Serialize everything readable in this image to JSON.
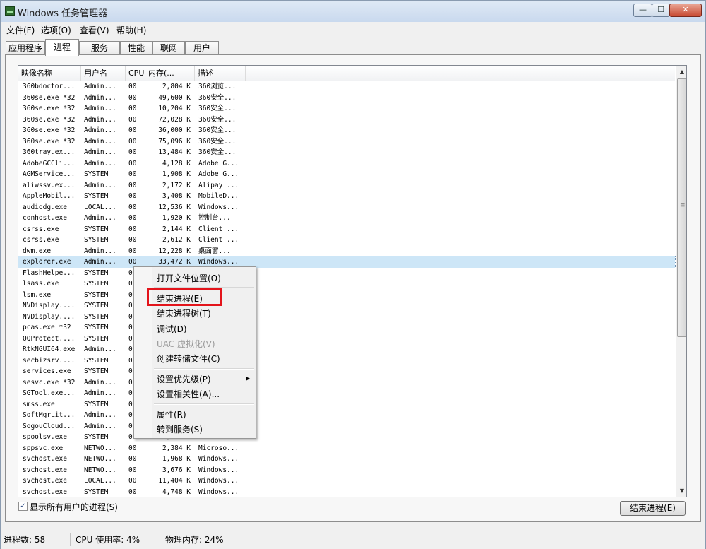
{
  "window": {
    "title": "Windows 任务管理器",
    "minimize_glyph": "—",
    "maximize_glyph": "☐",
    "close_glyph": "✕"
  },
  "menubar": {
    "items": [
      "文件(F)",
      "选项(O)",
      "查看(V)",
      "帮助(H)"
    ]
  },
  "tabs": {
    "items": [
      "应用程序",
      "进程",
      "服务",
      "性能",
      "联网",
      "用户"
    ],
    "active": "进程"
  },
  "process_table": {
    "columns": [
      "映像名称",
      "用户名",
      "CPU",
      "内存(...",
      "描述"
    ],
    "rows": [
      [
        "360bdoctor...",
        "Admin...",
        "00",
        "2,804 K",
        "360浏览..."
      ],
      [
        "360se.exe *32",
        "Admin...",
        "00",
        "49,600 K",
        "360安全..."
      ],
      [
        "360se.exe *32",
        "Admin...",
        "00",
        "10,204 K",
        "360安全..."
      ],
      [
        "360se.exe *32",
        "Admin...",
        "00",
        "72,028 K",
        "360安全..."
      ],
      [
        "360se.exe *32",
        "Admin...",
        "00",
        "36,000 K",
        "360安全..."
      ],
      [
        "360se.exe *32",
        "Admin...",
        "00",
        "75,096 K",
        "360安全..."
      ],
      [
        "360tray.ex...",
        "Admin...",
        "00",
        "13,484 K",
        "360安全..."
      ],
      [
        "AdobeGCCli...",
        "Admin...",
        "00",
        "4,128 K",
        "Adobe G..."
      ],
      [
        "AGMService...",
        "SYSTEM",
        "00",
        "1,908 K",
        "Adobe G..."
      ],
      [
        "aliwssv.ex...",
        "Admin...",
        "00",
        "2,172 K",
        "Alipay ..."
      ],
      [
        "AppleMobil...",
        "SYSTEM",
        "00",
        "3,408 K",
        "MobileD..."
      ],
      [
        "audiodg.exe",
        "LOCAL...",
        "00",
        "12,536 K",
        "Windows..."
      ],
      [
        "conhost.exe",
        "Admin...",
        "00",
        "1,920 K",
        "控制台..."
      ],
      [
        "csrss.exe",
        "SYSTEM",
        "00",
        "2,144 K",
        "Client ..."
      ],
      [
        "csrss.exe",
        "SYSTEM",
        "00",
        "2,612 K",
        "Client ..."
      ],
      [
        "dwm.exe",
        "Admin...",
        "00",
        "12,228 K",
        "桌面窗..."
      ],
      [
        "explorer.exe",
        "Admin...",
        "00",
        "33,472 K",
        "Windows..."
      ],
      [
        "FlashHelpe...",
        "SYSTEM",
        "0",
        "",
        ""
      ],
      [
        "lsass.exe",
        "SYSTEM",
        "0",
        "",
        ""
      ],
      [
        "lsm.exe",
        "SYSTEM",
        "0",
        "",
        ""
      ],
      [
        "NVDisplay....",
        "SYSTEM",
        "0",
        "",
        ""
      ],
      [
        "NVDisplay....",
        "SYSTEM",
        "0",
        "",
        ""
      ],
      [
        "pcas.exe *32",
        "SYSTEM",
        "0",
        "",
        ""
      ],
      [
        "QQProtect....",
        "SYSTEM",
        "0",
        "",
        ""
      ],
      [
        "RtkNGUI64.exe",
        "Admin...",
        "0",
        "",
        ""
      ],
      [
        "secbizsrv....",
        "SYSTEM",
        "0",
        "",
        ""
      ],
      [
        "services.exe",
        "SYSTEM",
        "0",
        "",
        ""
      ],
      [
        "sesvc.exe *32",
        "Admin...",
        "0",
        "",
        ""
      ],
      [
        "SGTool.exe...",
        "Admin...",
        "0",
        "",
        ""
      ],
      [
        "smss.exe",
        "SYSTEM",
        "0",
        "",
        ""
      ],
      [
        "SoftMgrLit...",
        "Admin...",
        "0",
        "",
        ""
      ],
      [
        "SogouCloud...",
        "Admin...",
        "0",
        "",
        ""
      ],
      [
        "spoolsv.exe",
        "SYSTEM",
        "00",
        "5,292 K",
        "后台处..."
      ],
      [
        "sppsvc.exe",
        "NETWO...",
        "00",
        "2,384 K",
        "Microso..."
      ],
      [
        "svchost.exe",
        "NETWO...",
        "00",
        "1,968 K",
        "Windows..."
      ],
      [
        "svchost.exe",
        "NETWO...",
        "00",
        "3,676 K",
        "Windows..."
      ],
      [
        "svchost.exe",
        "LOCAL...",
        "00",
        "11,404 K",
        "Windows..."
      ],
      [
        "svchost.exe",
        "SYSTEM",
        "00",
        "4,748 K",
        "Windows..."
      ]
    ],
    "selected_row": "explorer.exe"
  },
  "context_menu": {
    "items": [
      {
        "label": "打开文件位置(O)",
        "enabled": true
      },
      {
        "label": "结束进程(E)",
        "enabled": true,
        "highlighted": true
      },
      {
        "label": "结束进程树(T)",
        "enabled": true
      },
      {
        "label": "调试(D)",
        "enabled": true
      },
      {
        "label": "UAC 虚拟化(V)",
        "enabled": false
      },
      {
        "label": "创建转储文件(C)",
        "enabled": true
      },
      {
        "label": "设置优先级(P)",
        "enabled": true,
        "submenu": true
      },
      {
        "label": "设置相关性(A)...",
        "enabled": true
      },
      {
        "label": "属性(R)",
        "enabled": true
      },
      {
        "label": "转到服务(S)",
        "enabled": true
      }
    ],
    "highlight_color": "#e3141b"
  },
  "bottom": {
    "show_all_label": "显示所有用户的进程(S)",
    "show_all_checked": true,
    "end_button_label": "结束进程(E)"
  },
  "statusbar": {
    "process_count": "进程数: 58",
    "cpu_usage": "CPU 使用率: 4%",
    "memory": "物理内存: 24%"
  }
}
